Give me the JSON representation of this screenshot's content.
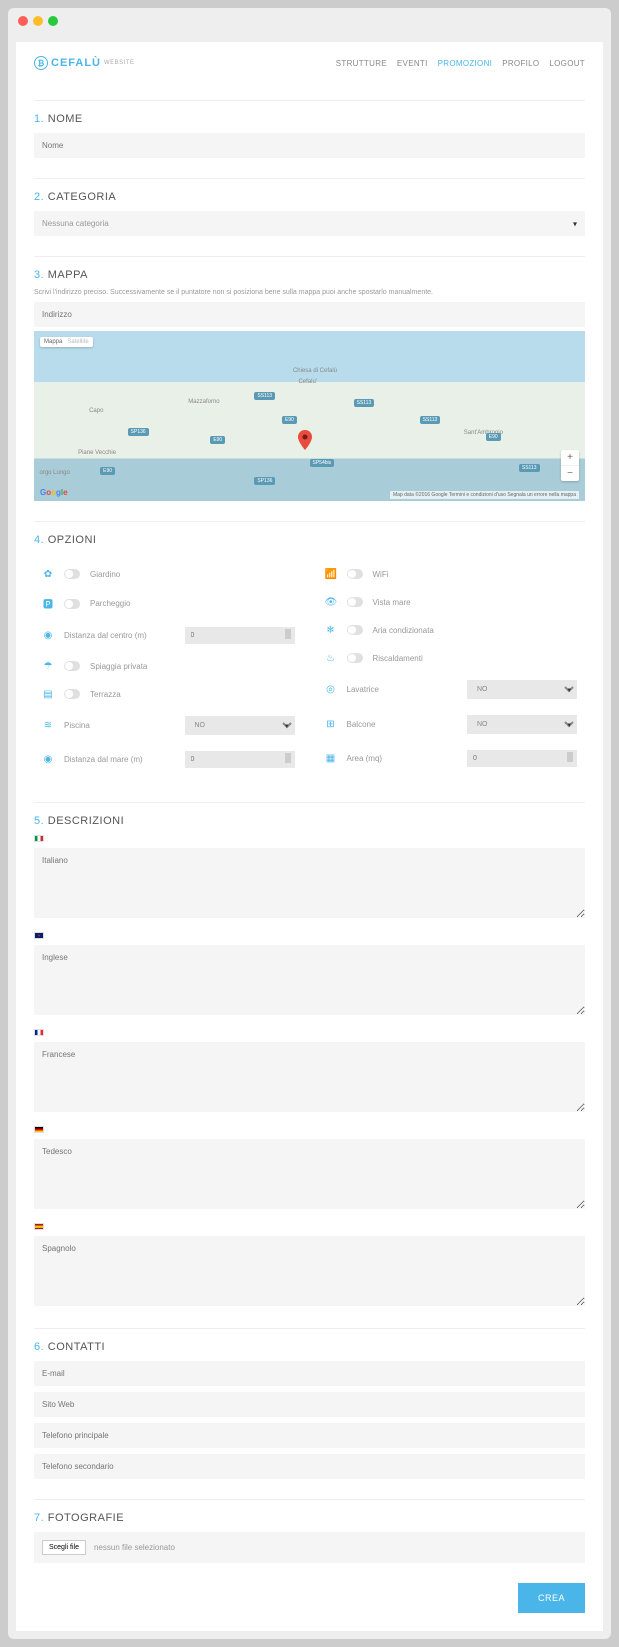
{
  "brand": {
    "name": "CEFALÙ",
    "sub": "WEBSITE"
  },
  "nav": {
    "strutture": "STRUTTURE",
    "eventi": "EVENTI",
    "promozioni": "PROMOZIONI",
    "profilo": "PROFILO",
    "logout": "LOGOUT"
  },
  "sections": {
    "nome": {
      "num": "1.",
      "title": "NOME",
      "placeholder": "Nome"
    },
    "categoria": {
      "num": "2.",
      "title": "CATEGORIA",
      "placeholder": "Nessuna categoria"
    },
    "mappa": {
      "num": "3.",
      "title": "MAPPA",
      "hint": "Scrivi l'indirizzo preciso. Successivamente se il puntatore non si posiziona bene sulla mappa puoi anche spostarlo manualmente.",
      "placeholder": "Indirizzo"
    },
    "opzioni": {
      "num": "4.",
      "title": "OPZIONI"
    },
    "descrizioni": {
      "num": "5.",
      "title": "DESCRIZIONI"
    },
    "contatti": {
      "num": "6.",
      "title": "CONTATTI"
    },
    "fotografie": {
      "num": "7.",
      "title": "FOTOGRAFIE"
    }
  },
  "map": {
    "tab1": "Mappa",
    "tab2": "Satellite",
    "labels": {
      "cefalu": "Cefalu'",
      "chiesa": "Chiesa di Cefalù",
      "mazzaforno": "Mazzaforno",
      "capo": "Capo",
      "pianevecchie": "Piane Vecchie",
      "orgolungo": "orgo Lungo",
      "santambrogio": "Sant'Ambrogio"
    },
    "roads": {
      "ss113a": "SS113",
      "ss113b": "SS113",
      "ss113c": "SS113",
      "ss113d": "SS113",
      "sp136a": "SP136",
      "sp136b": "SP136",
      "e90a": "E90",
      "e90b": "E90",
      "e90c": "E90",
      "e90d": "E90",
      "sp54bis": "SP54bis"
    },
    "attr": "Map data ©2016 Google   Termini e condizioni d'uso   Segnala un errore nella mappa"
  },
  "opts": {
    "giardino": "Giardino",
    "parcheggio": "Parcheggio",
    "distcentro": "Distanza dal centro (m)",
    "spiaggia": "Spiaggia privata",
    "terrazza": "Terrazza",
    "piscina": "Piscina",
    "distmare": "Distanza dal mare (m)",
    "wifi": "WiFi",
    "vistamare": "Vista mare",
    "aria": "Aria condizionata",
    "riscaldamenti": "Riscaldamenti",
    "lavatrice": "Lavatrice",
    "balcone": "Balcone",
    "area": "Area (mq)",
    "no": "NO",
    "zero": "0"
  },
  "desc": {
    "it": "Italiano",
    "en": "Inglese",
    "fr": "Francese",
    "de": "Tedesco",
    "es": "Spagnolo"
  },
  "contatti": {
    "email": "E-mail",
    "sito": "Sito Web",
    "tel1": "Telefono principale",
    "tel2": "Telefono secondario"
  },
  "foto": {
    "btn": "Scegli file",
    "label": "nessun file selezionato"
  },
  "submit": "CREA"
}
